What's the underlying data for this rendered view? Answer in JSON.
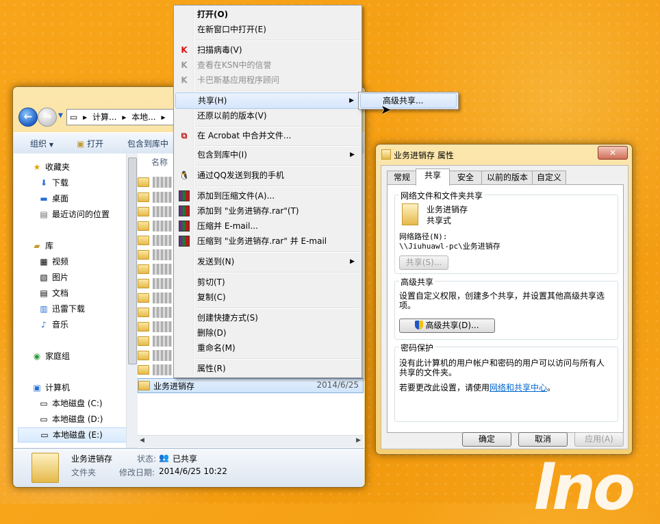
{
  "explorer": {
    "address_parts": [
      "计算...",
      "本地..."
    ],
    "toolbar": {
      "organize": "组织",
      "open": "打开",
      "include_in_library": "包含到库中"
    },
    "nav": {
      "favorites": "收藏夹",
      "favorites_items": [
        "下载",
        "桌面",
        "最近访问的位置"
      ],
      "libraries": "库",
      "libraries_items": [
        "视频",
        "图片",
        "文档",
        "迅雷下载",
        "音乐"
      ],
      "homegroup": "家庭组",
      "computer": "计算机",
      "drives": [
        "本地磁盘 (C:)",
        "本地磁盘 (D:)",
        "本地磁盘 (E:)"
      ]
    },
    "column_name": "名称",
    "selected_folder": {
      "name": "业务进销存",
      "date": "2014/6/25"
    },
    "details": {
      "name": "业务进销存",
      "type": "文件夹",
      "state_label": "状态:",
      "state_value": "已共享",
      "modified_label": "修改日期:",
      "modified_value": "2014/6/25 10:22"
    }
  },
  "context_menu": {
    "open": "打开(O)",
    "open_new_window": "在新窗口中打开(E)",
    "scan_virus": "扫描病毒(V)",
    "ksn": "查看在KSN中的信誉",
    "kaspersky_advisor": "卡巴斯基应用程序顾问",
    "share": "共享(H)",
    "restore_versions": "还原以前的版本(V)",
    "acrobat_merge": "在 Acrobat 中合并文件...",
    "include_library": "包含到库中(I)",
    "qq_send": "通过QQ发送到我的手机",
    "add_archive": "添加到压缩文件(A)...",
    "add_rar": "添加到 \"业务进销存.rar\"(T)",
    "compress_email": "压缩并 E-mail...",
    "compress_rar_email": "压缩到 \"业务进销存.rar\" 并 E-mail",
    "send_to": "发送到(N)",
    "cut": "剪切(T)",
    "copy": "复制(C)",
    "create_shortcut": "创建快捷方式(S)",
    "delete": "删除(D)",
    "rename": "重命名(M)",
    "properties": "属性(R)"
  },
  "submenu": {
    "advanced_share": "高级共享..."
  },
  "properties": {
    "title": "业务进销存 属性",
    "close": "✕",
    "tabs": [
      "常规",
      "共享",
      "安全",
      "以前的版本",
      "自定义"
    ],
    "network_group_title": "网络文件和文件夹共享",
    "folder_name": "业务进销存",
    "share_state": "共享式",
    "network_path_label": "网络路径(N):",
    "network_path": "\\\\Jiuhuawl-pc\\业务进销存",
    "share_button": "共享(S)...",
    "advanced_group_title": "高级共享",
    "advanced_desc_line1": "设置自定义权限，创建多个共享，并设置其他高级共享选",
    "advanced_desc_line2": "项。",
    "advanced_button": "高级共享(D)...",
    "password_group_title": "密码保护",
    "password_desc_line1": "没有此计算机的用户帐户和密码的用户可以访问与所有人",
    "password_desc_line2": "共享的文件夹。",
    "password_change_prefix": "若要更改此设置，请使用",
    "password_change_link": "网络和共享中心",
    "password_change_suffix": "。",
    "ok": "确定",
    "cancel": "取消",
    "apply": "应用(A)"
  }
}
